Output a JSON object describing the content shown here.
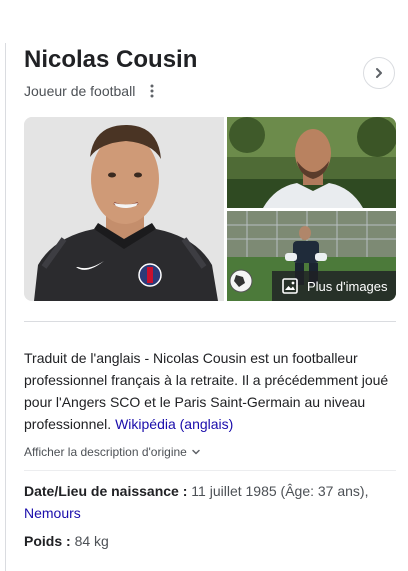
{
  "entity": {
    "title": "Nicolas Cousin",
    "subtitle": "Joueur de football"
  },
  "icons": {
    "more": "more-vert-icon",
    "next": "chevron-right-icon",
    "images": "image-icon",
    "expand": "chevron-down-icon"
  },
  "images": {
    "more_label": "Plus d'images"
  },
  "description": {
    "text": "Traduit de l'anglais - Nicolas Cousin est un footballeur professionnel français à la retraite. Il a précédemment joué pour l'Angers SCO et le Paris Saint-Germain au niveau professionnel. ",
    "source_link": "Wikipédia (anglais)",
    "show_original": "Afficher la description d'origine"
  },
  "facts": {
    "birth_label": "Date/Lieu de naissance : ",
    "birth_value": "11 juillet 1985 (Âge: 37 ans),",
    "birth_place": "Nemours",
    "weight_label": "Poids : ",
    "weight_value": "84 kg"
  },
  "colors": {
    "link": "#1a0dab",
    "text": "#202124",
    "secondary": "#4d5156",
    "border": "#dadce0"
  }
}
